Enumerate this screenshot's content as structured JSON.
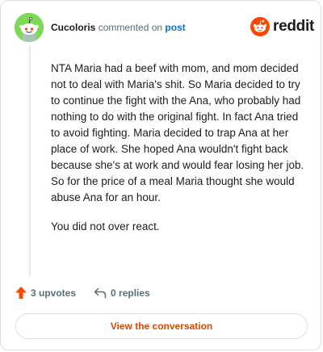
{
  "header": {
    "username": "Cucoloris",
    "action_text": "commented on",
    "post_link": "post",
    "brand": "reddit"
  },
  "comment": {
    "paragraphs": [
      "NTA Maria had a beef with mom, and mom decided not to deal with Maria's shit. So Maria decided to try to continue the fight with the Ana, who probably had nothing to do with the original fight. In fact Ana tried to avoid fighting. Maria decided to trap Ana at her place of work. She hoped Ana wouldn't fight back because she's at work and would fear losing her job. So for the price of a meal Maria thought she would abuse Ana for an hour.",
      "You did not over react."
    ]
  },
  "actions": {
    "upvotes": "3 upvotes",
    "replies": "0 replies"
  },
  "footer": {
    "view_label": "View the conversation"
  },
  "colors": {
    "upvote": "#ff4500",
    "link": "#0a6fd6",
    "button_text": "#d94a00",
    "avatar_bg": "#7ed957"
  },
  "icons": [
    "snoo-avatar-icon",
    "reddit-logo-icon",
    "upvote-arrow-icon",
    "reply-arrow-icon"
  ]
}
